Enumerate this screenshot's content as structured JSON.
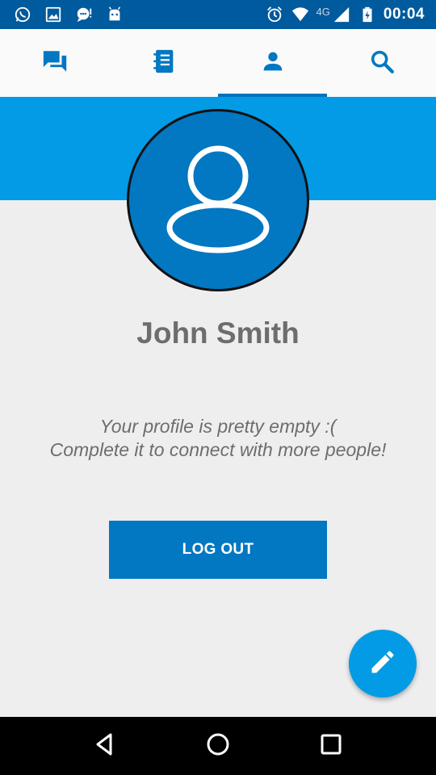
{
  "status_bar": {
    "left_icons": [
      "whatsapp-icon",
      "image-icon",
      "chat-bubble-icon",
      "android-icon"
    ],
    "network_label": "4G",
    "time": "00:04"
  },
  "tabs": [
    {
      "icon": "chats-icon",
      "active": false
    },
    {
      "icon": "contacts-book-icon",
      "active": false
    },
    {
      "icon": "person-icon",
      "active": true
    },
    {
      "icon": "search-icon",
      "active": false
    }
  ],
  "profile": {
    "name": "John Smith",
    "empty_line1": "Your profile is pretty empty :(",
    "empty_line2": "Complete it to connect with more people!"
  },
  "actions": {
    "logout_label": "LOG OUT",
    "fab_icon": "edit-pencil-icon"
  },
  "colors": {
    "status_bar": "#005a9e",
    "accent": "#039be5",
    "primary_dark": "#0277c2",
    "tab_active": "#0073bd",
    "text_gray": "#6d6d6d"
  }
}
